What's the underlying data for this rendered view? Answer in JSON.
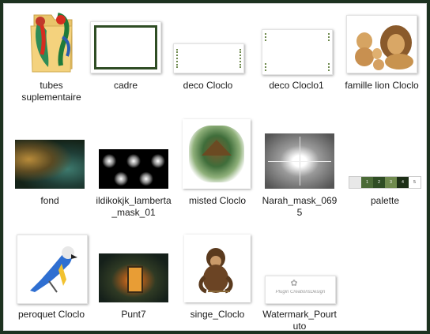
{
  "items": [
    {
      "label": "tubes suplementaire",
      "icon": "folder-icon"
    },
    {
      "label": "cadre",
      "icon": "frame-image-icon"
    },
    {
      "label": "deco Cloclo",
      "icon": "deco-image-icon"
    },
    {
      "label": "deco Cloclo1",
      "icon": "deco-image-icon"
    },
    {
      "label": "famille lion Cloclo",
      "icon": "lion-family-image-icon"
    },
    {
      "label": "fond",
      "icon": "background-image-icon"
    },
    {
      "label": "ildikokjk_lamberta_mask_01",
      "icon": "mask-image-icon"
    },
    {
      "label": "misted Cloclo",
      "icon": "misted-image-icon"
    },
    {
      "label": "Narah_mask_0695",
      "icon": "mask-image-icon"
    },
    {
      "label": "palette",
      "icon": "palette-image-icon"
    },
    {
      "label": "peroquet Cloclo",
      "icon": "parrot-image-icon"
    },
    {
      "label": "Punt7",
      "icon": "forest-image-icon"
    },
    {
      "label": "singe_Cloclo",
      "icon": "monkey-image-icon"
    },
    {
      "label": "Watermark_Pourtuto",
      "icon": "watermark-image-icon"
    }
  ],
  "palette_swatches": [
    "#e8e8e8",
    "#4b6b37",
    "#2f4d24",
    "#6f8a4e",
    "#1c2e16",
    "#ffffff"
  ],
  "palette_labels": [
    "",
    "1",
    "2",
    "3",
    "4",
    "5"
  ],
  "watermark_text": "Plugin CreationsDesign",
  "colors": {
    "frame": "#1d3220",
    "background": "#ffffff",
    "text": "#1b1b1b"
  }
}
